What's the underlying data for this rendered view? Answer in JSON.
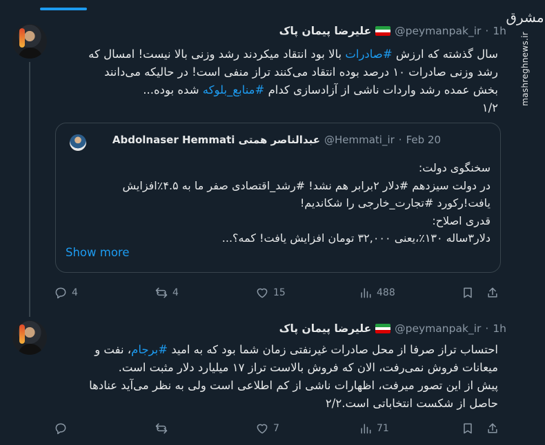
{
  "watermark": {
    "logo": "مشرق",
    "url": "mashreghnews.ir"
  },
  "tweets": [
    {
      "author_name": "علیرضا پیمان پاک",
      "handle": "@peymanpak_ir",
      "dot": "·",
      "time": "1h",
      "text_lines": [
        "سال گذشته که ارزش #صادرات بالا بود انتقاد میکردند رشد وزنی بالا نیست! امسال که",
        "رشد وزنی صادرات ۱۰ درصد بوده انتقاد می‌کنند تراز منفی است! در حالیکه می‌دانند",
        "بخش عمده رشد واردات ناشی از آزادسازی کدام #منابع_بلوکه شده بوده...",
        "۱/۲"
      ],
      "quote": {
        "author_name": "Abdolnaser Hemmati عبدالناصر همتی",
        "handle": "@Hemmati_ir",
        "dot": "·",
        "date": "Feb 20",
        "lines": [
          "سخنگوی دولت:",
          "در دولت سیزدهم #دلار ۲برابر هم نشد! #رشد_اقتصادی صفر ما به ۴.۵٪افزایش",
          "یافت!رکورد #تجارت_خارجی را شکاندیم!",
          "قدری اصلاح:",
          "دلار۳ساله ۱۳۰٪،یعنی ۳۲,۰۰۰ تومان افزایش یافت! کمه؟..."
        ],
        "show_more": "Show more"
      },
      "stats": {
        "replies": "4",
        "reposts": "4",
        "likes": "15",
        "views": "488"
      }
    },
    {
      "author_name": "علیرضا پیمان پاک",
      "handle": "@peymanpak_ir",
      "dot": "·",
      "time": "1h",
      "text_lines": [
        "احتساب تراز صرفا از محل صادرات غیرنفتی زمان شما بود که به امید #برجام، نفت و",
        "میعانات فروش نمی‌رفت، الان که فروش بالاست تراز ۱۷ میلیارد دلار مثبت است.",
        "پیش از این تصور میرفت، اظهارات ناشی از کم اطلاعی است ولی به نظر می‌آید عنادها",
        "حاصل از شکست انتخاباتی است.۲/۲"
      ],
      "stats": {
        "replies": "",
        "reposts": "",
        "likes": "7",
        "views": "71"
      }
    }
  ],
  "colors": {
    "background": "#15202b",
    "accent": "#1d9bf0",
    "muted": "#8b98a5",
    "border": "#38444d",
    "text": "#e7e9ea"
  }
}
